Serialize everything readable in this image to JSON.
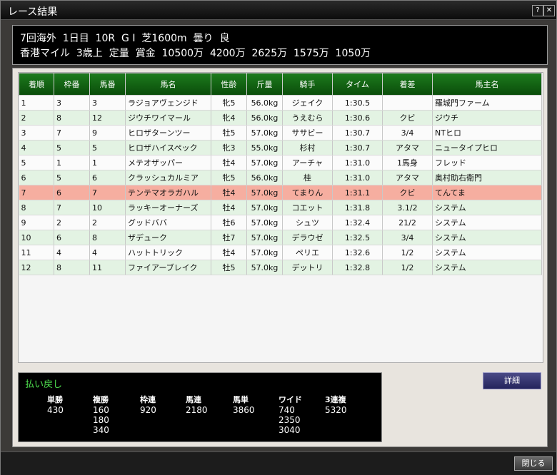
{
  "window": {
    "title": "レース結果",
    "help_label": "?",
    "close_label": "✕"
  },
  "race": {
    "line1": "7回海外  1日目  10R  G I  芝1600m  曇り  良",
    "line2": "香港マイル  3歳上  定量  賞金  10500万  4200万  2625万  1575万  1050万"
  },
  "table": {
    "headers": [
      "着順",
      "枠番",
      "馬番",
      "馬名",
      "性齢",
      "斤量",
      "騎手",
      "タイム",
      "着差",
      "馬主名"
    ],
    "rows": [
      {
        "rank": "1",
        "waku": "3",
        "uma": "3",
        "name": "ラジョアヴェンジド",
        "sex_age": "牝5",
        "weight": "56.0kg",
        "jockey": "ジェイク",
        "time": "1:30.5",
        "margin": "",
        "owner": "羅城門ファーム"
      },
      {
        "rank": "2",
        "waku": "8",
        "uma": "12",
        "name": "ジウチワイマール",
        "sex_age": "牝4",
        "weight": "56.0kg",
        "jockey": "うえむら",
        "time": "1:30.6",
        "margin": "クビ",
        "owner": "ジウチ"
      },
      {
        "rank": "3",
        "waku": "7",
        "uma": "9",
        "name": "ヒロザターンツー",
        "sex_age": "牡5",
        "weight": "57.0kg",
        "jockey": "ササビー",
        "time": "1:30.7",
        "margin": "3/4",
        "owner": "NTヒロ"
      },
      {
        "rank": "4",
        "waku": "5",
        "uma": "5",
        "name": "ヒロザハイスペック",
        "sex_age": "牝3",
        "weight": "55.0kg",
        "jockey": "杉村",
        "time": "1:30.7",
        "margin": "アタマ",
        "owner": "ニュータイプヒロ"
      },
      {
        "rank": "5",
        "waku": "1",
        "uma": "1",
        "name": "メテオザッパー",
        "sex_age": "牡4",
        "weight": "57.0kg",
        "jockey": "アーチャ",
        "time": "1:31.0",
        "margin": "1馬身",
        "owner": "フレッド"
      },
      {
        "rank": "6",
        "waku": "5",
        "uma": "6",
        "name": "クラッシュカルミア",
        "sex_age": "牝5",
        "weight": "56.0kg",
        "jockey": "桂",
        "time": "1:31.0",
        "margin": "アタマ",
        "owner": "奥村助右衛門"
      },
      {
        "rank": "7",
        "waku": "6",
        "uma": "7",
        "name": "テンテマオラガハル",
        "sex_age": "牡4",
        "weight": "57.0kg",
        "jockey": "てまりん",
        "time": "1:31.1",
        "margin": "クビ",
        "owner": "てんてま"
      },
      {
        "rank": "8",
        "waku": "7",
        "uma": "10",
        "name": "ラッキーオーナーズ",
        "sex_age": "牡4",
        "weight": "57.0kg",
        "jockey": "コエット",
        "time": "1:31.8",
        "margin": "3.1/2",
        "owner": "システム"
      },
      {
        "rank": "9",
        "waku": "2",
        "uma": "2",
        "name": "グッドババ",
        "sex_age": "牡6",
        "weight": "57.0kg",
        "jockey": "シュツ",
        "time": "1:32.4",
        "margin": "21/2",
        "owner": "システム"
      },
      {
        "rank": "10",
        "waku": "6",
        "uma": "8",
        "name": "ザデューク",
        "sex_age": "牡7",
        "weight": "57.0kg",
        "jockey": "デラウゼ",
        "time": "1:32.5",
        "margin": "3/4",
        "owner": "システム"
      },
      {
        "rank": "11",
        "waku": "4",
        "uma": "4",
        "name": "ハットトリック",
        "sex_age": "牡4",
        "weight": "57.0kg",
        "jockey": "ペリエ",
        "time": "1:32.6",
        "margin": "1/2",
        "owner": "システム"
      },
      {
        "rank": "12",
        "waku": "8",
        "uma": "11",
        "name": "ファイアーブレイク",
        "sex_age": "牡5",
        "weight": "57.0kg",
        "jockey": "デットリ",
        "time": "1:32.8",
        "margin": "1/2",
        "owner": "システム"
      }
    ]
  },
  "payout": {
    "title": "払い戻し",
    "columns": [
      {
        "label": "単勝",
        "values": [
          "430"
        ]
      },
      {
        "label": "複勝",
        "values": [
          "160",
          "180",
          "340"
        ]
      },
      {
        "label": "枠連",
        "values": [
          "920"
        ]
      },
      {
        "label": "馬連",
        "values": [
          "2180"
        ]
      },
      {
        "label": "馬単",
        "values": [
          "3860"
        ]
      },
      {
        "label": "ワイド",
        "values": [
          "740",
          "2350",
          "3040"
        ]
      },
      {
        "label": "3連複",
        "values": [
          "5320"
        ]
      }
    ]
  },
  "buttons": {
    "detail_label": "詳細",
    "close_label": "閉じる"
  },
  "colors": {
    "header_green": "#1c7a1c",
    "highlight_row": "#f6aea0",
    "payout_title": "#4fe04f"
  }
}
